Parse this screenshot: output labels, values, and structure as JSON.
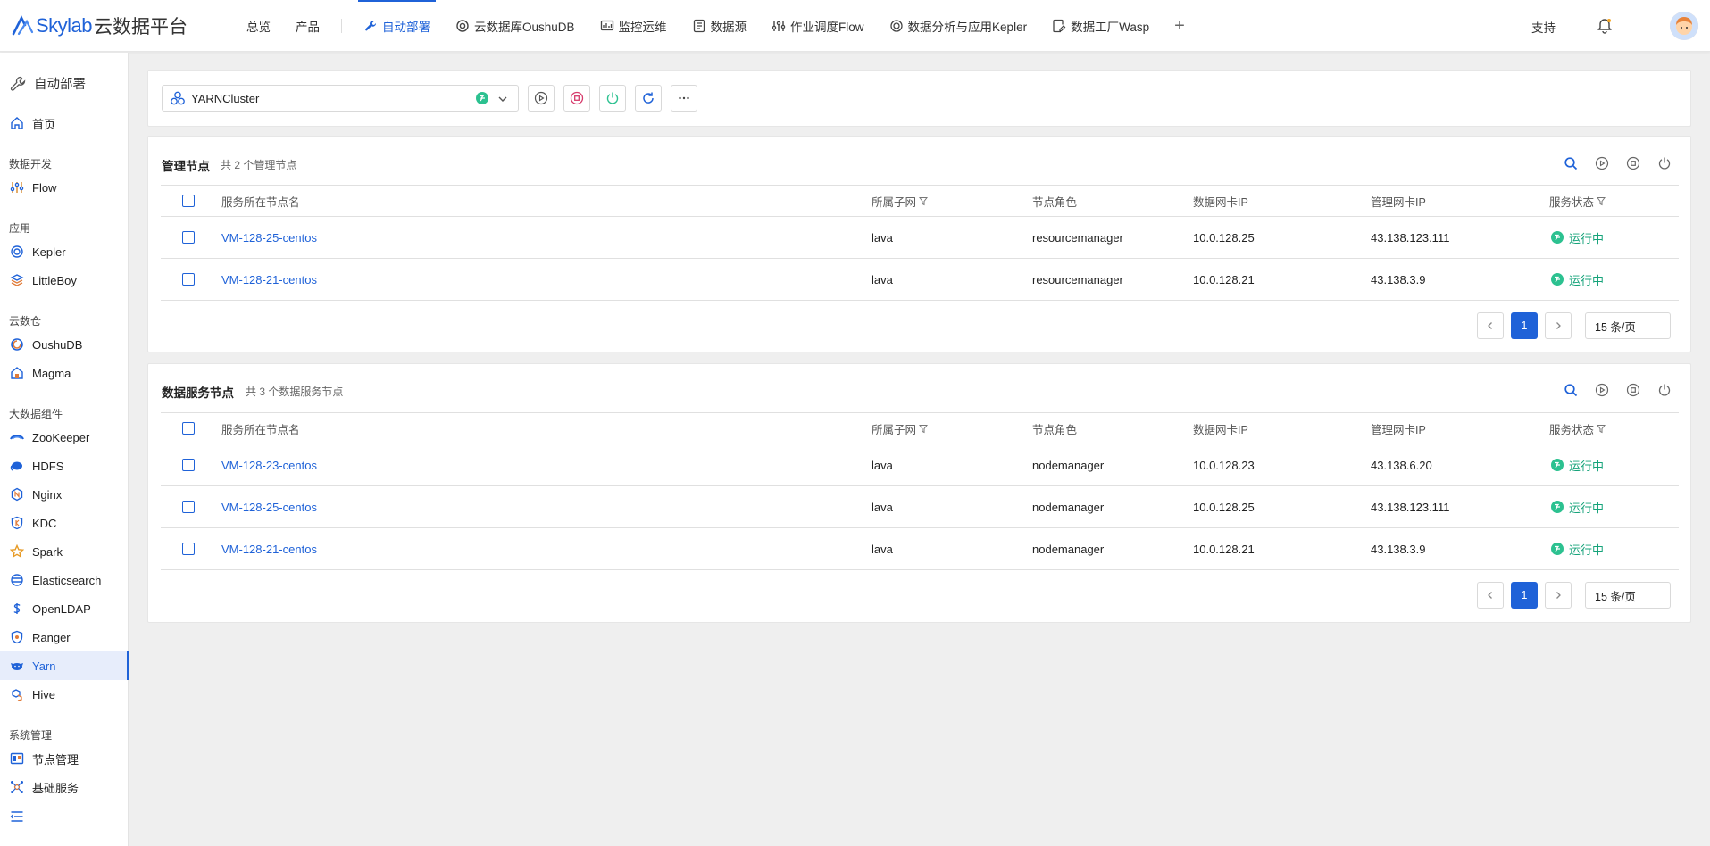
{
  "brand": {
    "name": "Skylab",
    "subtitle": "云数据平台"
  },
  "nav": {
    "items": [
      {
        "label": "总览"
      },
      {
        "label": "产品"
      },
      {
        "label": "自动部署"
      },
      {
        "label": "云数据库OushuDB"
      },
      {
        "label": "监控运维"
      },
      {
        "label": "数据源"
      },
      {
        "label": "作业调度Flow"
      },
      {
        "label": "数据分析与应用Kepler"
      },
      {
        "label": "数据工厂Wasp"
      }
    ],
    "support": "支持"
  },
  "sidebar": {
    "title": "自动部署",
    "home": "首页",
    "groups": [
      {
        "label": "数据开发",
        "items": [
          {
            "label": "Flow"
          }
        ]
      },
      {
        "label": "应用",
        "items": [
          {
            "label": "Kepler"
          },
          {
            "label": "LittleBoy"
          }
        ]
      },
      {
        "label": "云数仓",
        "items": [
          {
            "label": "OushuDB"
          },
          {
            "label": "Magma"
          }
        ]
      },
      {
        "label": "大数据组件",
        "items": [
          {
            "label": "ZooKeeper"
          },
          {
            "label": "HDFS"
          },
          {
            "label": "Nginx"
          },
          {
            "label": "KDC"
          },
          {
            "label": "Spark"
          },
          {
            "label": "Elasticsearch"
          },
          {
            "label": "OpenLDAP"
          },
          {
            "label": "Ranger"
          },
          {
            "label": "Yarn"
          },
          {
            "label": "Hive"
          }
        ]
      },
      {
        "label": "系统管理",
        "items": [
          {
            "label": "节点管理"
          },
          {
            "label": "基础服务"
          }
        ]
      }
    ]
  },
  "cluster": {
    "selected": "YARNCluster"
  },
  "columns": [
    "服务所在节点名",
    "所属子网",
    "节点角色",
    "数据网卡IP",
    "管理网卡IP",
    "服务状态"
  ],
  "manage": {
    "title": "管理节点",
    "count": "共 2 个管理节点",
    "rows": [
      {
        "name": "VM-128-25-centos",
        "subnet": "lava",
        "role": "resourcemanager",
        "data_ip": "10.0.128.25",
        "mgmt_ip": "43.138.123.111",
        "status": "运行中"
      },
      {
        "name": "VM-128-21-centos",
        "subnet": "lava",
        "role": "resourcemanager",
        "data_ip": "10.0.128.21",
        "mgmt_ip": "43.138.3.9",
        "status": "运行中"
      }
    ],
    "page": "1",
    "page_size": "15 条/页"
  },
  "data_nodes": {
    "title": "数据服务节点",
    "count": "共 3 个数据服务节点",
    "rows": [
      {
        "name": "VM-128-23-centos",
        "subnet": "lava",
        "role": "nodemanager",
        "data_ip": "10.0.128.23",
        "mgmt_ip": "43.138.6.20",
        "status": "运行中"
      },
      {
        "name": "VM-128-25-centos",
        "subnet": "lava",
        "role": "nodemanager",
        "data_ip": "10.0.128.25",
        "mgmt_ip": "43.138.123.111",
        "status": "运行中"
      },
      {
        "name": "VM-128-21-centos",
        "subnet": "lava",
        "role": "nodemanager",
        "data_ip": "10.0.128.21",
        "mgmt_ip": "43.138.3.9",
        "status": "运行中"
      }
    ],
    "page": "1",
    "page_size": "15 条/页"
  },
  "colors": {
    "accent": "#1f62d8",
    "running": "#2cc190",
    "running_text": "#16a37a"
  }
}
